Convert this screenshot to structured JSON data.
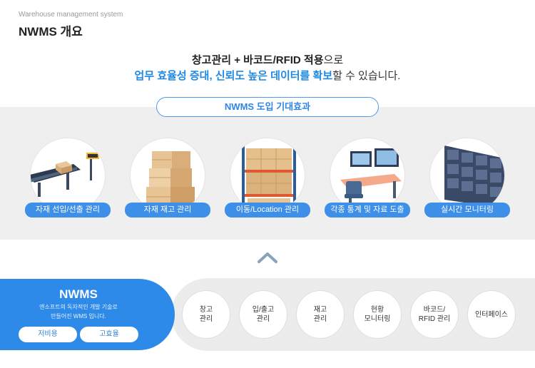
{
  "header": {
    "subtitle": "Warehouse management system",
    "title": "NWMS 개요"
  },
  "headline": {
    "line1_bold": "창고관리 + 바코드/RFID 적용",
    "line1_rest": "으로",
    "line2_blue": "업무 효율성 증대, 신뢰도 높은 데이터를 확보",
    "line2_rest": "할 수 있습니다."
  },
  "effects": {
    "title": "NWMS 도입 기대효과",
    "items": [
      {
        "label": "자재 선입/선출 관리",
        "icon": "conveyor-icon"
      },
      {
        "label": "자재 재고 관리",
        "icon": "boxes-icon"
      },
      {
        "label": "이동/Location 관리",
        "icon": "pallet-rack-icon"
      },
      {
        "label": "각종 통계 및 자료 도출",
        "icon": "workstation-icon"
      },
      {
        "label": "실시간 모니터링",
        "icon": "monitor-wall-icon"
      }
    ]
  },
  "summary": {
    "title": "NWMS",
    "desc_line1": "엔소프트의 독자적인 개발 기술로",
    "desc_line2": "만들어진 WMS 입니다.",
    "badge1": "저비용",
    "badge2": "고효율"
  },
  "functions": [
    {
      "line1": "창고",
      "line2": "관리"
    },
    {
      "line1": "입/출고",
      "line2": "관리"
    },
    {
      "line1": "재고",
      "line2": "관리"
    },
    {
      "line1": "현황",
      "line2": "모니터링"
    },
    {
      "line1": "바코드/",
      "line2": "RFID 관리"
    },
    {
      "line1": "인터페이스",
      "line2": ""
    }
  ],
  "colors": {
    "accent": "#2e8ae8",
    "text_blue": "#1e88e5",
    "band": "#efefef"
  }
}
